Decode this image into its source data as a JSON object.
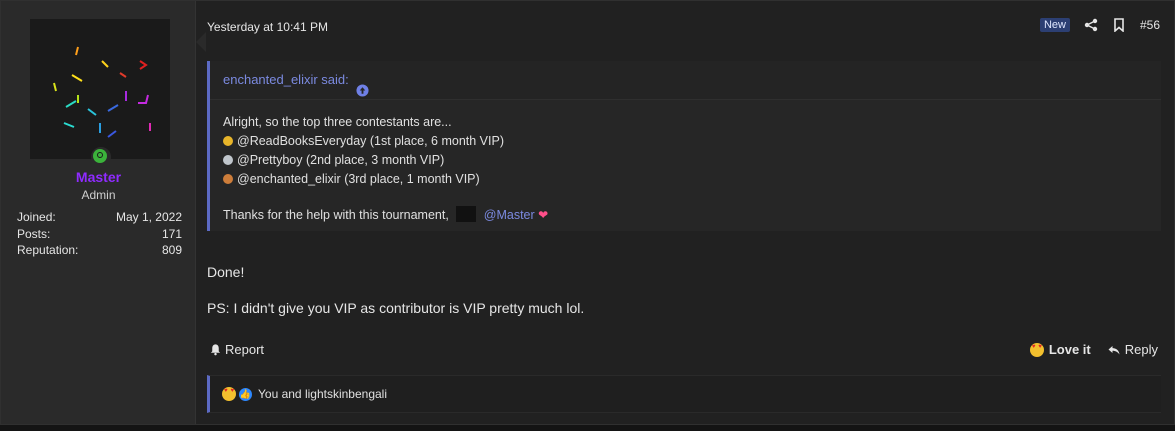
{
  "user": {
    "name": "Master",
    "title": "Admin",
    "stats": [
      {
        "label": "Joined:",
        "value": "May 1, 2022"
      },
      {
        "label": "Posts:",
        "value": "171"
      },
      {
        "label": "Reputation:",
        "value": "809"
      }
    ]
  },
  "post": {
    "date": "Yesterday at 10:41 PM",
    "badge": "New",
    "number": "#56",
    "quote": {
      "author": "enchanted_elixir said:",
      "lines": [
        "Alright, so the top three contestants are...",
        "@ReadBooksEveryday (1st place, 6 month VIP)",
        "@Prettyboy (2nd place, 3 month VIP)",
        "@enchanted_elixir (3rd place, 1 month VIP)"
      ],
      "thanks": "Thanks for the help with this tournament,",
      "mention": "@Master"
    },
    "body": [
      "Done!",
      "PS: I didn't give you VIP as contributor is VIP pretty much lol."
    ],
    "actions": {
      "report": "Report",
      "love": "Love it",
      "reply": "Reply"
    },
    "reactions": "You and lightskinbengali"
  },
  "colors": {
    "accent": "#5c6ac4",
    "username": "#8f2bff",
    "online": "#3bb33b",
    "badge_bg": "#2c3f73"
  },
  "icons": [
    "share-icon",
    "bookmark-icon",
    "arrow-up-circle-icon",
    "bell-icon",
    "heart-eyes-icon",
    "reply-icon",
    "like-icon",
    "medal-icon",
    "heart-sparkle-icon"
  ]
}
